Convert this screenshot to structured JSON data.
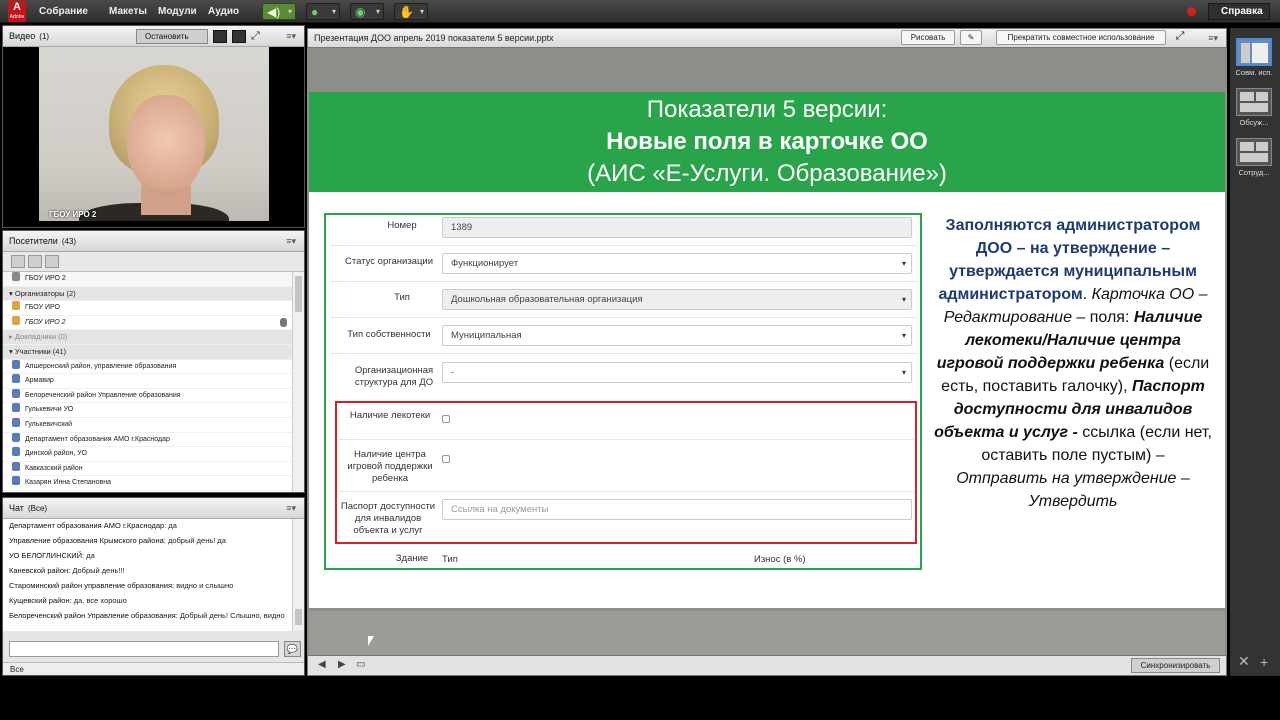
{
  "topbar": {
    "logo": "A",
    "logo_sub": "Adobe",
    "menus": [
      "Собрание",
      "Макеты",
      "Модули",
      "Аудио"
    ],
    "help": "Справка"
  },
  "video_pod": {
    "title": "Видео",
    "count": "(1)",
    "stop_button": "Остановить",
    "camera_label": "ГБОУ ИРО 2"
  },
  "attendees_pod": {
    "title": "Посетители",
    "count": "(43)",
    "current_user": "ГБОУ ИРО 2",
    "groups": [
      {
        "label": "Организаторы (2)",
        "members": [
          "ГБОУ ИРО",
          "ГБОУ ИРО 2"
        ]
      },
      {
        "label": "Докладчики (0)",
        "members": []
      },
      {
        "label": "Участники (41)",
        "members": [
          "Апшеронский район, управление образования",
          "Армавир",
          "Белореченский район Управление образования",
          "Гулькевичи УО",
          "Гулькевичский",
          "Департамент образования АМО г.Краснодар",
          "Динской район, УО",
          "Кавказский район",
          "Казарян Инна Степановна"
        ]
      }
    ]
  },
  "chat_pod": {
    "title": "Чат",
    "scope": "(Все)",
    "messages": [
      {
        "from": "Департамент образования АМО г.Краснодар:",
        "text": "да"
      },
      {
        "from": "Управление образования Крымского района:",
        "text": "добрый день! да"
      },
      {
        "from": "УО БЕЛОГЛИНСКИЙ:",
        "text": "да"
      },
      {
        "from": "Каневской район:",
        "text": "Добрый день!!!"
      },
      {
        "from": "Староминский район управление образования:",
        "text": "видно и слышно"
      },
      {
        "from": "Кущевский район:",
        "text": "да, все хорошо"
      },
      {
        "from": "Белореченский район Управление образования:",
        "text": "Добрый день! Слышно, видно"
      }
    ],
    "recipient": "Все"
  },
  "share_pod": {
    "title": "Презентация ДОО апрель 2019 показатели 5 версии.pptx",
    "draw_button": "Рисовать",
    "stop_share_button": "Прекратить совместное использование",
    "sync_button": "Синхронизировать"
  },
  "slide": {
    "title_line1": "Показатели 5 версии:",
    "title_line2": "Новые поля в карточке ОО",
    "title_line3": "(АИС «Е-Услуги. Образование»)",
    "form": {
      "number_label": "Номер",
      "number_value": "1389",
      "status_label": "Статус организации",
      "status_value": "Функционирует",
      "type_label": "Тип",
      "type_value": "Дошкольная образовательная организация",
      "ownership_label": "Тип собственности",
      "ownership_value": "Муниципальная",
      "structure_label": "Организационная структура для ДО",
      "structure_value": "-",
      "lekoteka_label": "Наличие лекотеки",
      "play_center_label": "Наличие центра игровой поддержки ребенка",
      "passport_label": "Паспорт доступности для инвалидов объекта и услуг",
      "passport_placeholder": "Ссылка на документы",
      "building_label": "Здание",
      "type_col": "Тип",
      "wear_col": "Износ (в %)"
    },
    "side_text": {
      "p1": "Заполняются администратором ДОО – на утверждение – утверждается муниципальным администратором",
      "p1_dot": ".",
      "p2a": "Карточка ОО – Редактирование",
      "p2b": " – поля: ",
      "p2c": "Наличие лекотеки/Наличие центра игровой поддержки ребенка",
      "p2d": " (если есть, поставить галочку), ",
      "p2e": "Паспорт доступности для инвалидов объекта и услуг -",
      "p2f": " ссылка (если нет, оставить поле пустым) – ",
      "p2g": "Отправить на утверждение – Утвердить"
    }
  },
  "layouts": [
    {
      "label": "Совм. исп."
    },
    {
      "label": "Обсуж..."
    },
    {
      "label": "Сотруд..."
    }
  ],
  "colors": {
    "slide_green": "#2aa44a",
    "highlight_red": "#d4202a",
    "accent_blue": "#1f3a6e"
  }
}
